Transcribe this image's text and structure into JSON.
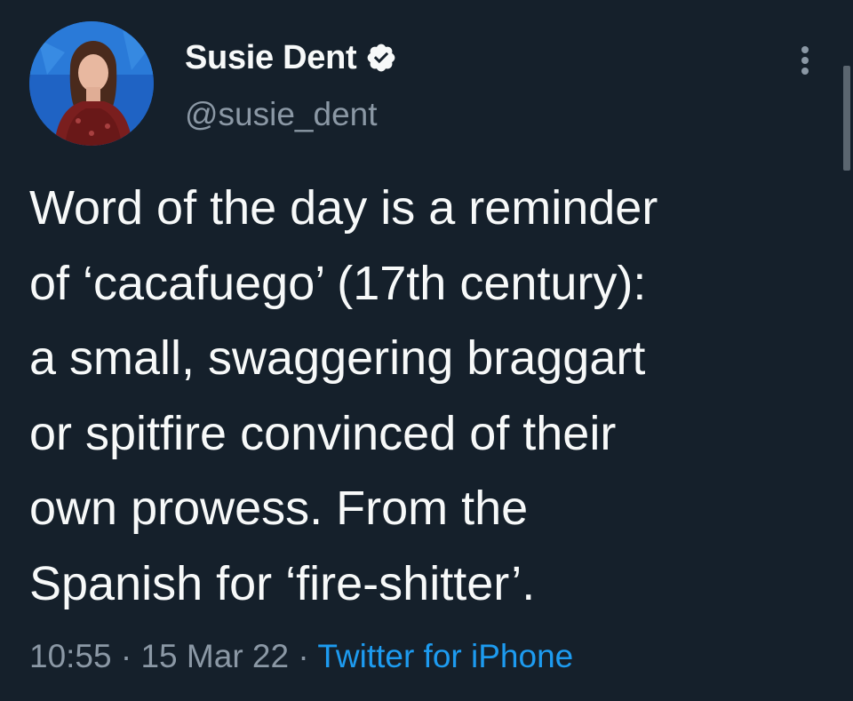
{
  "tweet": {
    "author": {
      "display_name": "Susie Dent",
      "handle": "@susie_dent",
      "verified": true,
      "avatar_icon": "profile-photo"
    },
    "text": "Word of the day is a reminder\nof ‘cacafuego’ (17th century):\na small, swaggering braggart\nor spitfire convinced of their\nown prowess. From the\nSpanish for ‘fire-shitter’.",
    "time": "10:55",
    "date": "15 Mar 22",
    "separator": "·",
    "source": "Twitter for iPhone"
  },
  "icons": {
    "verified": "verified-badge-icon",
    "more": "more-options-icon"
  },
  "colors": {
    "background": "#15202b",
    "text_primary": "#f7f9f9",
    "text_secondary": "#8b98a5",
    "link": "#1d9bf0"
  }
}
